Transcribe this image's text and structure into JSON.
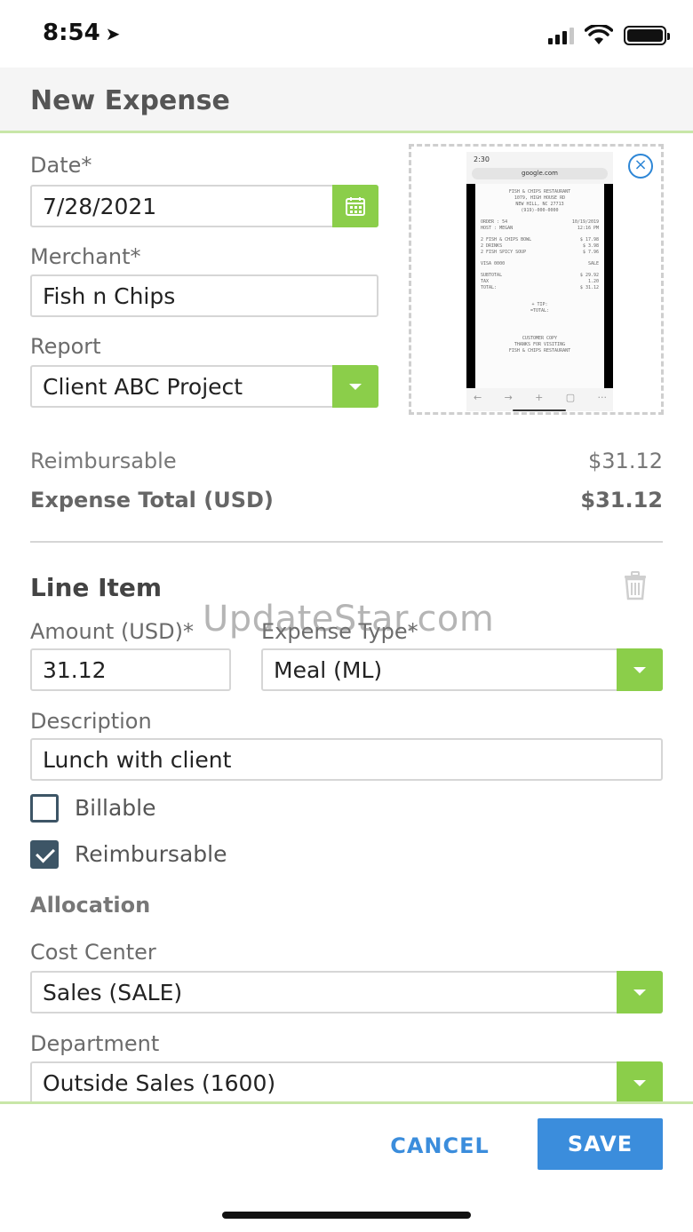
{
  "status_bar": {
    "time": "8:54",
    "location_glyph": "➤"
  },
  "header": {
    "title": "New Expense"
  },
  "form": {
    "date": {
      "label": "Date*",
      "value": "7/28/2021",
      "icon": "calendar-icon"
    },
    "merchant": {
      "label": "Merchant*",
      "value": "Fish n Chips"
    },
    "report": {
      "label": "Report",
      "value": "Client ABC Project"
    }
  },
  "receipt": {
    "phone_time": "2:30",
    "url": "google.com",
    "lines": {
      "l1": "FISH & CHIPS RESTAURANT",
      "l2": "1079, HIGH HOUSE RD",
      "l3": "NEW HILL, NC 27713",
      "l4": "(919)-000-0000",
      "order": "ORDER : 54",
      "order_date": "10/19/2019",
      "host": "HOST : MEGAN",
      "host_time": "12:16 PM",
      "item1": "2 FISH & CHIPS BOWL",
      "item1_price": "$ 17.98",
      "item2": "2 DRINKS",
      "item2_price": "$ 3.98",
      "item3": "2 FISH SPICY SOUP",
      "item3_price": "$ 7.96",
      "visa": "VISA 0000",
      "visa_type": "SALE",
      "subtotal": "SUBTOTAL",
      "subtotal_val": "$ 29.92",
      "tax": "TAX",
      "tax_val": "1.20",
      "total": "TOTAL:",
      "total_val": "$ 31.12",
      "tip": "+ TIP:",
      "total2": "=TOTAL:",
      "customer": "CUSTOMER COPY",
      "thanks": "THANKS FOR VISITING",
      "thanks2": "FISH & CHIPS RESTAURANT"
    }
  },
  "totals": {
    "reimbursable_label": "Reimbursable",
    "reimbursable_value": "$31.12",
    "expense_total_label": "Expense Total (USD)",
    "expense_total_value": "$31.12"
  },
  "line_item": {
    "title": "Line Item",
    "amount": {
      "label": "Amount (USD)*",
      "value": "31.12"
    },
    "expense_type": {
      "label": "Expense Type*",
      "value": "Meal (ML)"
    },
    "description": {
      "label": "Description",
      "value": "Lunch with client"
    },
    "billable": {
      "label": "Billable",
      "checked": false
    },
    "reimbursable": {
      "label": "Reimbursable",
      "checked": true
    }
  },
  "allocation": {
    "title": "Allocation",
    "cost_center": {
      "label": "Cost Center",
      "value": "Sales (SALE)"
    },
    "department": {
      "label": "Department",
      "value": "Outside Sales (1600)"
    }
  },
  "watermark": "UpdateStar.com",
  "footer": {
    "cancel_label": "CANCEL",
    "save_label": "SAVE"
  },
  "colors": {
    "accent_green": "#8bce4a",
    "primary_blue": "#3b8ddc",
    "checkbox_dark": "#3d5566"
  }
}
